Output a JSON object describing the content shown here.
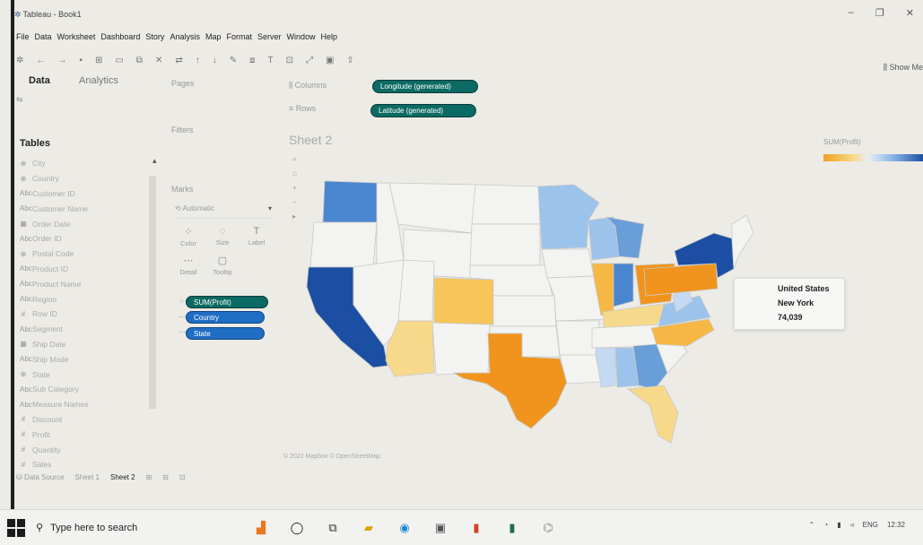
{
  "window": {
    "title": "Tableau - Book1",
    "controls": [
      "–",
      "❐",
      "✕"
    ]
  },
  "menu": [
    "File",
    "Data",
    "Worksheet",
    "Dashboard",
    "Story",
    "Analysis",
    "Map",
    "Format",
    "Server",
    "Window",
    "Help"
  ],
  "toolbar": {
    "show_me": "Show Me"
  },
  "data_pane": {
    "tab_data": "Data",
    "tab_analytics": "Analytics",
    "tables_heading": "Tables",
    "fields": [
      {
        "icon": "⊕",
        "name": "City"
      },
      {
        "icon": "⊕",
        "name": "Country"
      },
      {
        "icon": "Abc",
        "name": "Customer ID"
      },
      {
        "icon": "Abc",
        "name": "Customer Name"
      },
      {
        "icon": "▦",
        "name": "Order Date"
      },
      {
        "icon": "Abc",
        "name": "Order ID"
      },
      {
        "icon": "⊕",
        "name": "Postal Code"
      },
      {
        "icon": "Abc",
        "name": "Product ID"
      },
      {
        "icon": "Abc",
        "name": "Product Name"
      },
      {
        "icon": "Abc",
        "name": "Region"
      },
      {
        "icon": "#",
        "name": "Row ID"
      },
      {
        "icon": "Abc",
        "name": "Segment"
      },
      {
        "icon": "▦",
        "name": "Ship Date"
      },
      {
        "icon": "Abc",
        "name": "Ship Mode"
      },
      {
        "icon": "⊕",
        "name": "State"
      },
      {
        "icon": "Abc",
        "name": "Sub Category"
      },
      {
        "icon": "Abc",
        "name": "Measure Names"
      },
      {
        "icon": "#",
        "name": "Discount"
      },
      {
        "icon": "#",
        "name": "Profit"
      },
      {
        "icon": "#",
        "name": "Quantity"
      },
      {
        "icon": "#",
        "name": "Sales"
      }
    ]
  },
  "shelves": {
    "columns_label": "Columns",
    "rows_label": "Rows",
    "columns_pill": "Longitude (generated)",
    "rows_pill": "Latitude (generated)"
  },
  "cards": {
    "pages": "Pages",
    "filters": "Filters",
    "marks": "Marks",
    "mark_type": "Automatic",
    "mark_buttons": [
      {
        "icon": "⁘",
        "label": "Color"
      },
      {
        "icon": "◌",
        "label": "Size"
      },
      {
        "icon": "T",
        "label": "Label"
      },
      {
        "icon": "⋯",
        "label": "Detail"
      },
      {
        "icon": "▢",
        "label": "Tooltip"
      }
    ],
    "mark_pills": [
      "SUM(Profit)",
      "Country",
      "State"
    ]
  },
  "view": {
    "sheet_title": "Sheet 2",
    "attribution": "© 2022 Mapbox © OpenStreetMap"
  },
  "legend": {
    "title": "SUM(Profit)"
  },
  "tooltip": [
    {
      "value": "United States"
    },
    {
      "value": "New York"
    },
    {
      "value": "74,039"
    }
  ],
  "sheet_tabs": {
    "data_source": "Data Source",
    "sheets": [
      "Sheet 1",
      "Sheet 2"
    ],
    "active": "Sheet 2"
  },
  "taskbar": {
    "search_placeholder": "Type here to search",
    "tray_lang": "ENG",
    "tray_time": "12:32"
  },
  "map_colors": {
    "deep_blue": "#1c4fa3",
    "mid_blue": "#4a86d0",
    "light_blue": "#9cc3ec",
    "pale": "#f3f3f1",
    "deep_orange": "#f0941d",
    "mid_orange": "#f7b744",
    "light_orange": "#f7d98c"
  }
}
